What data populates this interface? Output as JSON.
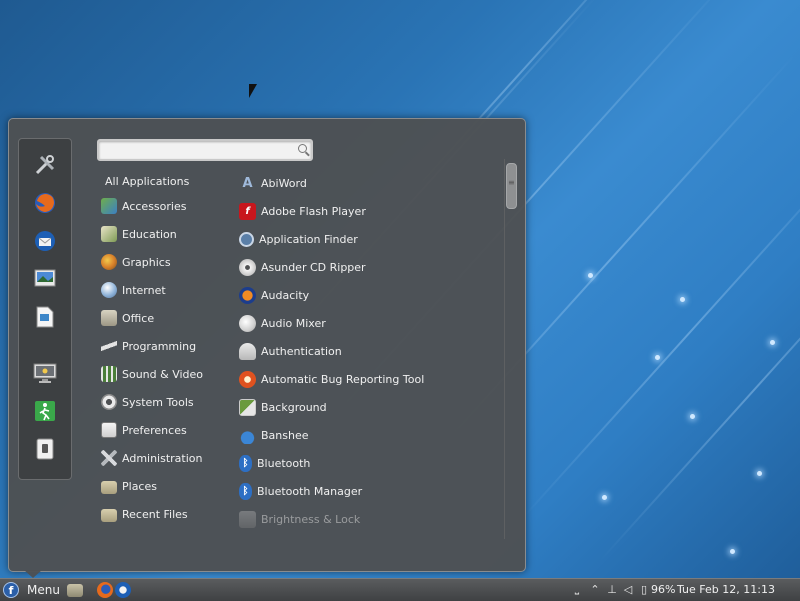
{
  "search": {
    "value": "",
    "placeholder": ""
  },
  "categories": [
    {
      "label": "All Applications",
      "icon": "none"
    },
    {
      "label": "Accessories",
      "icon": "accessories-icon"
    },
    {
      "label": "Education",
      "icon": "education-icon"
    },
    {
      "label": "Graphics",
      "icon": "graphics-icon"
    },
    {
      "label": "Internet",
      "icon": "internet-globe-icon"
    },
    {
      "label": "Office",
      "icon": "office-icon"
    },
    {
      "label": "Programming",
      "icon": "programming-icon"
    },
    {
      "label": "Sound & Video",
      "icon": "sound-video-icon"
    },
    {
      "label": "System Tools",
      "icon": "system-tools-gear-icon"
    },
    {
      "label": "Preferences",
      "icon": "preferences-icon"
    },
    {
      "label": "Administration",
      "icon": "administration-tools-icon"
    },
    {
      "label": "Places",
      "icon": "folder-icon"
    },
    {
      "label": "Recent Files",
      "icon": "folder-icon"
    }
  ],
  "apps": [
    {
      "label": "AbiWord",
      "icon": "abiword-icon"
    },
    {
      "label": "Adobe Flash Player",
      "icon": "flash-icon"
    },
    {
      "label": "Application Finder",
      "icon": "magnifier-icon"
    },
    {
      "label": "Asunder CD Ripper",
      "icon": "cd-icon"
    },
    {
      "label": "Audacity",
      "icon": "audacity-headphones-icon"
    },
    {
      "label": "Audio Mixer",
      "icon": "audio-mixer-icon"
    },
    {
      "label": "Authentication",
      "icon": "authentication-users-icon"
    },
    {
      "label": "Automatic Bug Reporting Tool",
      "icon": "bug-report-icon"
    },
    {
      "label": "Background",
      "icon": "background-icon"
    },
    {
      "label": "Banshee",
      "icon": "banshee-icon"
    },
    {
      "label": "Bluetooth",
      "icon": "bluetooth-icon"
    },
    {
      "label": "Bluetooth Manager",
      "icon": "bluetooth-icon"
    },
    {
      "label": "Brightness & Lock",
      "icon": "brightness-icon"
    }
  ],
  "favorites": [
    "tools-icon",
    "firefox-icon",
    "thunderbird-icon",
    "image-viewer-icon",
    "document-icon",
    "lock-screen-icon",
    "logout-icon",
    "shutdown-icon"
  ],
  "taskbar": {
    "menu_label": "Menu",
    "battery": "96%",
    "clock": "Tue Feb 12, 11:13"
  },
  "colors": {
    "menu_bg": "#4e5052",
    "desktop_blue": "#2a74b5",
    "taskbar": "#4a4c4e"
  }
}
